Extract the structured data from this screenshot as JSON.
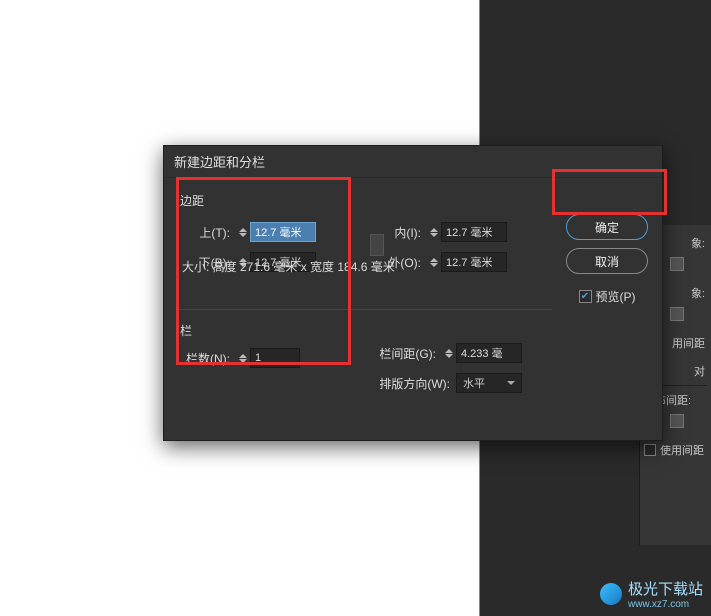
{
  "dialog": {
    "title": "新建边距和分栏",
    "margin_section": "边距",
    "top_label": "上(T):",
    "bottom_label": "下(B):",
    "inside_label": "内(I):",
    "outside_label": "外(O):",
    "top_value": "12.7 毫米",
    "bottom_value": "12.7 毫米",
    "inside_value": "12.7 毫米",
    "outside_value": "12.7 毫米",
    "columns_section": "栏",
    "count_label": "栏数(N):",
    "count_value": "1",
    "gutter_label": "栏间距(G):",
    "gutter_value": "4.233 毫",
    "direction_label": "排版方向(W):",
    "direction_value": "水平",
    "size_text": "大小: 高度 271.6 毫米 x 宽度 184.6 毫米",
    "ok": "确定",
    "cancel": "取消",
    "preview": "预览(P)"
  },
  "panel": {
    "align_obj": "象:",
    "distribute_obj": "象:",
    "use_spacing": "用间距",
    "spacing": "对",
    "dist_spacing": "分布间距:",
    "use_spacing2": "使用间距"
  },
  "watermark": {
    "text": "极光下载站",
    "url": "www.xz7.com"
  }
}
